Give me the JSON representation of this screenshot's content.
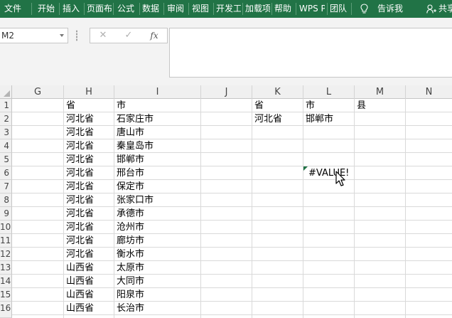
{
  "ribbon": {
    "tabs": [
      "文件",
      "开始",
      "插入",
      "页面布",
      "公式",
      "数据",
      "审阅",
      "视图",
      "开发工",
      "加载项",
      "帮助",
      "WPS P",
      "团队",
      "告诉我",
      "共享"
    ]
  },
  "formula_bar": {
    "name_box": "M2",
    "cancel_symbol": "✕",
    "enter_symbol": "✓",
    "fx_symbol": "fx",
    "formula": ""
  },
  "sheet": {
    "columns": [
      "G",
      "H",
      "I",
      "J",
      "K",
      "L",
      "M",
      "N"
    ],
    "rows": [
      "1",
      "2",
      "3",
      "4",
      "5",
      "6",
      "7",
      "8",
      "9",
      "10",
      "11",
      "12",
      "13",
      "14",
      "15",
      "16"
    ],
    "H": [
      "省",
      "河北省",
      "河北省",
      "河北省",
      "河北省",
      "河北省",
      "河北省",
      "河北省",
      "河北省",
      "河北省",
      "河北省",
      "河北省",
      "山西省",
      "山西省",
      "山西省",
      "山西省"
    ],
    "I": [
      "市",
      "石家庄市",
      "唐山市",
      "秦皇岛市",
      "邯郸市",
      "邢台市",
      "保定市",
      "张家口市",
      "承德市",
      "沧州市",
      "廊坊市",
      "衡水市",
      "太原市",
      "大同市",
      "阳泉市",
      "长治市"
    ],
    "K1": "省",
    "L1": "市",
    "M1": "县",
    "K2": "河北省",
    "L2": "邯郸市",
    "L6": "#VALUE!"
  },
  "colors": {
    "ribbon": "#217346",
    "error_indicator": "#217346"
  }
}
